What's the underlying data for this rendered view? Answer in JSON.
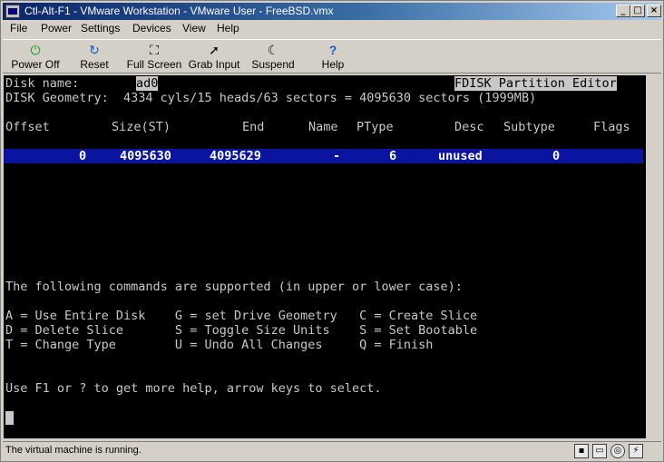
{
  "window": {
    "title": "Ctl-Alt-F1 - VMware Workstation - VMware User - FreeBSD.vmx",
    "min_glyph": "_",
    "max_glyph": "□",
    "close_glyph": "×"
  },
  "menubar": {
    "items": [
      "File",
      "Power",
      "Settings",
      "Devices",
      "View",
      "Help"
    ]
  },
  "toolbar": {
    "buttons": [
      {
        "label": "Power Off",
        "icon": "power-icon",
        "glyph": "⏻"
      },
      {
        "label": "Reset",
        "icon": "reset-icon",
        "glyph": "↻"
      },
      {
        "label": "Full Screen",
        "icon": "fullscreen-icon",
        "glyph": "⛶"
      },
      {
        "label": "Grab Input",
        "icon": "grab-input-icon",
        "glyph": "➚"
      },
      {
        "label": "Suspend",
        "icon": "suspend-icon",
        "glyph": "☾"
      },
      {
        "label": "Help",
        "icon": "help-icon",
        "glyph": "?"
      }
    ]
  },
  "console": {
    "disk_name_label": "Disk name:",
    "disk_name_value": "ad0",
    "editor_title": "FDISK Partition Editor",
    "geometry": "DISK Geometry:  4334 cyls/15 heads/63 sectors = 4095630 sectors (1999MB)",
    "headers": {
      "offset": "Offset",
      "size": "Size(ST)",
      "end": "End",
      "name": "Name",
      "ptype": "PType",
      "desc": "Desc",
      "subtype": "Subtype",
      "flags": "Flags"
    },
    "row": {
      "offset": "0",
      "size": "4095630",
      "end": "4095629",
      "name": "-",
      "ptype": "6",
      "desc": "unused",
      "subtype": "0"
    },
    "commands_intro": "The following commands are supported (in upper or lower case):",
    "commands": [
      "A = Use Entire Disk    G = set Drive Geometry   C = Create Slice",
      "D = Delete Slice       S = Toggle Size Units    S = Set Bootable",
      "T = Change Type        U = Undo All Changes     Q = Finish"
    ],
    "help_line": "Use F1 or ? to get more help, arrow keys to select."
  },
  "status": {
    "text": "The virtual machine is running.",
    "icons": [
      {
        "name": "floppy-icon",
        "glyph": "▪"
      },
      {
        "name": "hdd-icon",
        "glyph": "▭"
      },
      {
        "name": "cdrom-icon",
        "glyph": "◎"
      },
      {
        "name": "network-icon",
        "glyph": "⚡"
      }
    ]
  },
  "colors": {
    "title_gradient_start": "#0a246a",
    "console_bg": "#000000",
    "console_fg": "#c8c8c8",
    "selection_bg": "#0a14a0"
  }
}
